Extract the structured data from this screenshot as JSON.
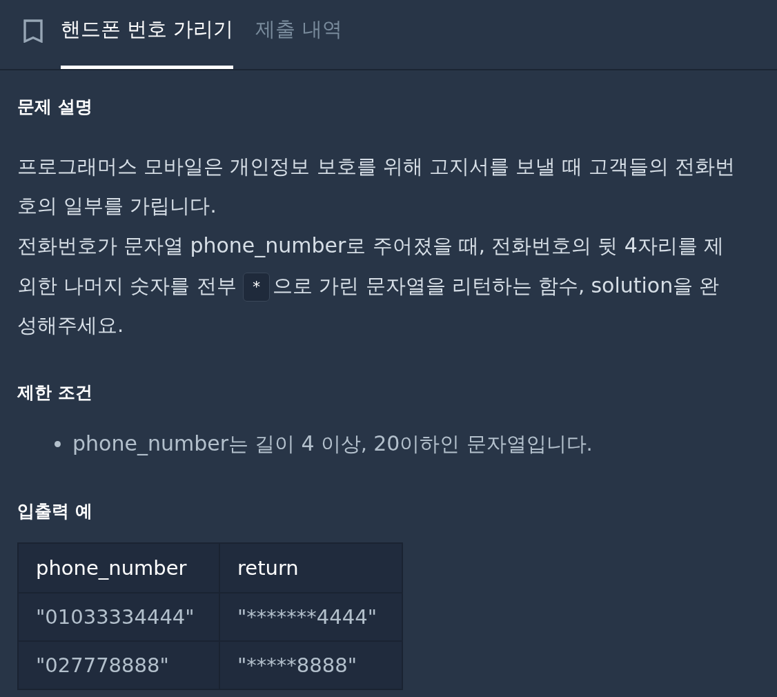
{
  "tabs": [
    {
      "label": "핸드폰 번호 가리기",
      "selected": true
    },
    {
      "label": "제출 내역",
      "selected": false
    }
  ],
  "sections": [
    {
      "kind": "text",
      "heading": "문제 설명",
      "paragraphs": [
        [
          {
            "kind": "text",
            "text": "프로그래머스 모바일은 개인정보 보호를 위해 고지서를 보낼 때 고객들의 전화번호의 일부를 가립니다."
          }
        ],
        [
          {
            "kind": "text",
            "text": "전화번호가 문자열 phone_number로 주어졌을 때, 전화번호의 뒷 4자리를 제외한 나머지 숫자를 전부 "
          },
          {
            "kind": "code",
            "text": "*"
          },
          {
            "kind": "text",
            "text": "으로 가린 문자열을 리턴하는 함수, solution을 완성해주세요."
          }
        ]
      ]
    },
    {
      "kind": "list",
      "heading": "제한 조건",
      "items": [
        "phone_number는 길이 4 이상, 20이하인 문자열입니다."
      ]
    },
    {
      "kind": "table",
      "heading": "입출력 예",
      "columns": [
        "phone_number",
        "return"
      ],
      "rows": [
        [
          "\"01033334444\"",
          "\"*******4444\""
        ],
        [
          "\"027778888\"",
          "\"*****8888\""
        ]
      ]
    }
  ]
}
